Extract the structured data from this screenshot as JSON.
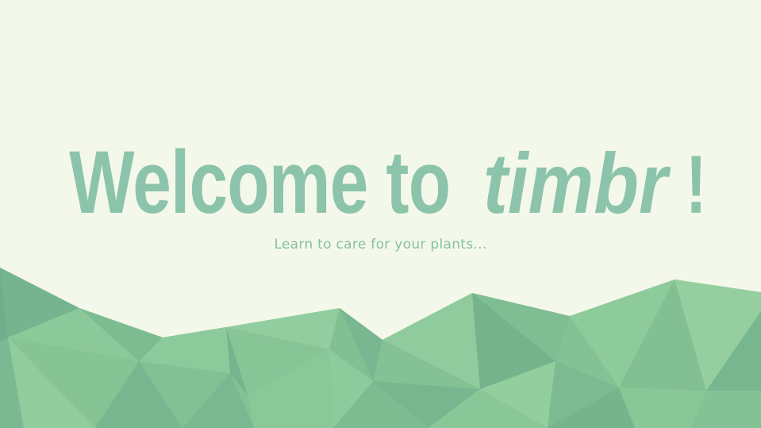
{
  "hero": {
    "welcome_word": "Welcome",
    "to_word": "to",
    "brand_name": "timbr",
    "exclamation": "!",
    "tagline": "Learn to care for your plants..."
  },
  "colors": {
    "background": "#f4f8ea",
    "headline": "#8cc4ab",
    "tagline": "#86c0a5"
  }
}
